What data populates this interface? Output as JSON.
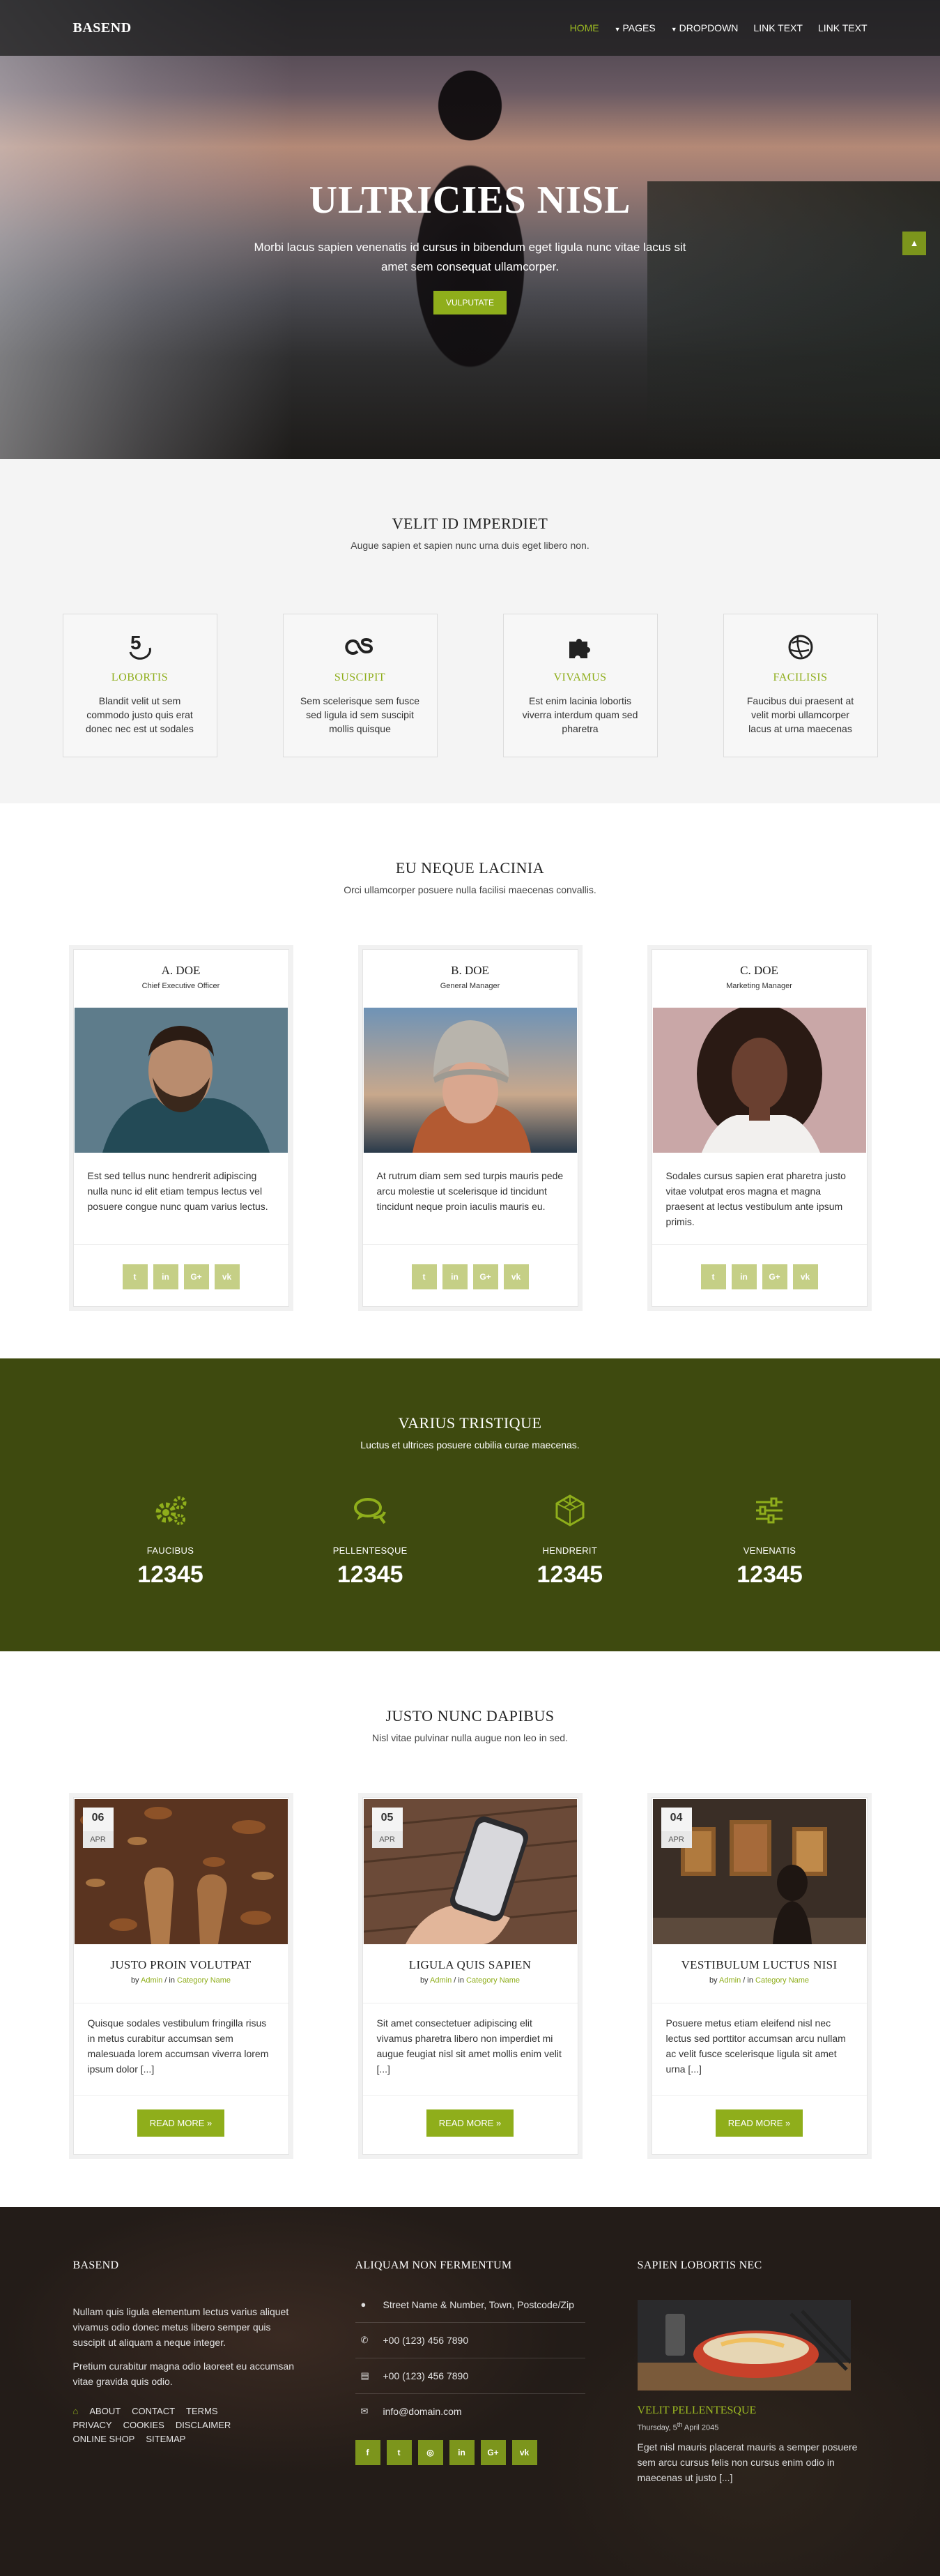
{
  "nav": {
    "brand": "BASEND",
    "items": [
      {
        "label": "HOME",
        "active": true,
        "dropdown": false
      },
      {
        "label": "PAGES",
        "active": false,
        "dropdown": true
      },
      {
        "label": "DROPDOWN",
        "active": false,
        "dropdown": true
      },
      {
        "label": "LINK TEXT",
        "active": false,
        "dropdown": false
      },
      {
        "label": "LINK TEXT",
        "active": false,
        "dropdown": false
      }
    ]
  },
  "hero": {
    "title": "ULTRICIES NISL",
    "text": "Morbi lacus sapien venenatis id cursus in bibendum eget ligula nunc vitae lacus sit amet sem consequat ullamcorper.",
    "button": "VULPUTATE",
    "arrow_icon": "chevron-up-icon"
  },
  "features": {
    "title": "VELIT ID IMPERDIET",
    "subtitle": "Augue sapien et sapien nunc urna duis eget libero non.",
    "items": [
      {
        "icon": "five-hundred-px-icon",
        "title": "LOBORTIS",
        "text": "Blandit velit ut sem commodo justo quis erat donec nec est ut sodales"
      },
      {
        "icon": "lastfm-icon",
        "title": "SUSCIPIT",
        "text": "Sem scelerisque sem fusce sed ligula id sem suscipit mollis quisque"
      },
      {
        "icon": "puzzle-icon",
        "title": "VIVAMUS",
        "text": "Est enim lacinia lobortis viverra interdum quam sed pharetra"
      },
      {
        "icon": "globe-icon",
        "title": "FACILISIS",
        "text": "Faucibus dui praesent at velit morbi ullamcorper lacus at urna maecenas"
      }
    ]
  },
  "team": {
    "title": "EU NEQUE LACINIA",
    "subtitle": "Orci ullamcorper posuere nulla facilisi maecenas convallis.",
    "members": [
      {
        "name": "A. DOE",
        "role": "Chief Executive Officer",
        "text": "Est sed tellus nunc hendrerit adipiscing nulla nunc id elit etiam tempus lectus vel posuere congue nunc quam varius lectus."
      },
      {
        "name": "B. DOE",
        "role": "General Manager",
        "text": "At rutrum diam sem sed turpis mauris pede arcu molestie ut scelerisque id tincidunt tincidunt neque proin iaculis mauris eu."
      },
      {
        "name": "C. DOE",
        "role": "Marketing Manager",
        "text": "Sodales cursus sapien erat pharetra justo vitae volutpat eros magna et magna praesent at lectus vestibulum ante ipsum primis."
      }
    ],
    "social_labels": [
      "t",
      "in",
      "G+",
      "vk"
    ]
  },
  "stats": {
    "title": "VARIUS TRISTIQUE",
    "subtitle": "Luctus et ultrices posuere cubilia curae maecenas.",
    "items": [
      {
        "icon": "cogs-icon",
        "label": "FAUCIBUS",
        "value": "12345"
      },
      {
        "icon": "comments-icon",
        "label": "PELLENTESQUE",
        "value": "12345"
      },
      {
        "icon": "cube-icon",
        "label": "HENDRERIT",
        "value": "12345"
      },
      {
        "icon": "sliders-icon",
        "label": "VENENATIS",
        "value": "12345"
      }
    ],
    "accent": "#9dbb22",
    "background": "#3e4a0f"
  },
  "blog": {
    "title": "JUSTO NUNC DAPIBUS",
    "subtitle": "Nisl vitae pulvinar nulla augue non leo in sed.",
    "posts": [
      {
        "day": "06",
        "month": "APR",
        "title": "JUSTO PROIN VOLUTPAT",
        "by": "by",
        "author": "Admin",
        "sep": "/ in",
        "category": "Category Name",
        "text": "Quisque sodales vestibulum fringilla risus in metus curabitur accumsan sem malesuada lorem accumsan viverra lorem ipsum dolor [...]",
        "button": "READ MORE »"
      },
      {
        "day": "05",
        "month": "APR",
        "title": "LIGULA QUIS SAPIEN",
        "by": "by",
        "author": "Admin",
        "sep": "/ in",
        "category": "Category Name",
        "text": "Sit amet consectetuer adipiscing elit vivamus pharetra libero non imperdiet mi augue feugiat nisl sit amet mollis enim velit [...]",
        "button": "READ MORE »"
      },
      {
        "day": "04",
        "month": "APR",
        "title": "VESTIBULUM LUCTUS NISI",
        "by": "by",
        "author": "Admin",
        "sep": "/ in",
        "category": "Category Name",
        "text": "Posuere metus etiam eleifend nisl nec lectus sed porttitor accumsan arcu nullam ac velit fusce scelerisque ligula sit amet urna [...]",
        "button": "READ MORE »"
      }
    ]
  },
  "footer": {
    "col1": {
      "title": "BASEND",
      "p1": "Nullam quis ligula elementum lectus varius aliquet vivamus odio donec metus libero semper quis suscipit ut aliquam a neque integer.",
      "p2": "Pretium curabitur magna odio laoreet eu accumsan vitae gravida quis odio.",
      "links": [
        "ABOUT",
        "CONTACT",
        "TERMS",
        "PRIVACY",
        "COOKIES",
        "DISCLAIMER",
        "ONLINE SHOP",
        "SITEMAP"
      ]
    },
    "col2": {
      "title": "ALIQUAM NON FERMENTUM",
      "address": "Street Name & Number, Town, Postcode/Zip",
      "phone": "+00 (123) 456 7890",
      "fax": "+00 (123) 456 7890",
      "email": "info@domain.com",
      "social_labels": [
        "f",
        "t",
        "◎",
        "in",
        "G+",
        "vk"
      ]
    },
    "col3": {
      "title": "SAPIEN LOBORTIS NEC",
      "post_title": "VELIT PELLENTESQUE",
      "post_date_prefix": "Thursday, 5",
      "post_date_sup": "th",
      "post_date_suffix": " April 2045",
      "post_text": "Eget nisl mauris placerat mauris a semper posuere sem arcu cursus felis non cursus enim odio in maecenas ut justo [...]"
    }
  }
}
